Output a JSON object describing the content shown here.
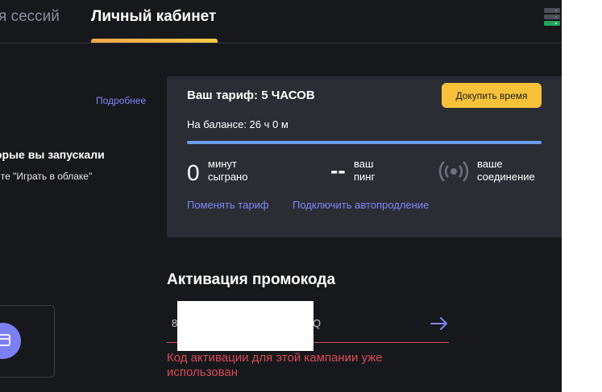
{
  "tabs": {
    "sessions": "я сессий",
    "cabinet": "Личный кабинет"
  },
  "left": {
    "more_link": "Подробнее",
    "games_title": "орые вы запускали",
    "games_hint": "ите \"Играть в облаке\""
  },
  "tariff": {
    "title": "Ваш тариф: 5 ЧАСОВ",
    "buy_button": "Докупить время",
    "balance": "На балансе: 26 ч 0 м",
    "progress_fraction": 1.0,
    "minutes_value": "0",
    "minutes_label": "минут сыграно",
    "ping_value": "--",
    "ping_label": "ваш пинг",
    "connection_label": "ваше соединение",
    "change_link": "Поменять тариф",
    "autorenew_link": "Подключить автопродление"
  },
  "promo": {
    "title": "Активация промокода",
    "value_start": "8",
    "value_end": "Q",
    "error": "Код активации для этой кампании уже использован"
  },
  "colors": {
    "accent": "#7f86f5",
    "error": "#d84a57",
    "button": "#f7c23a",
    "progress": "#6c9cec"
  },
  "icons": [
    "server-status-icon",
    "signal-icon",
    "arrow-right-icon",
    "card-icon"
  ]
}
